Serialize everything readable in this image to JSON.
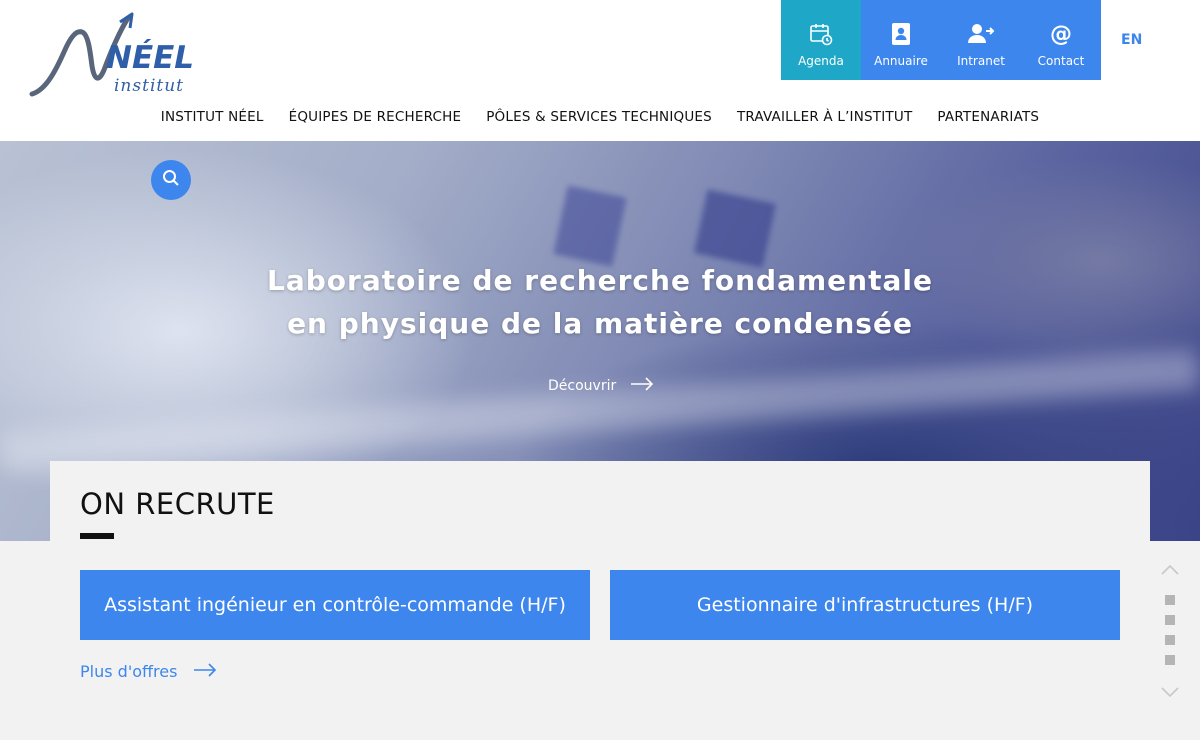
{
  "header": {
    "logo_text": "NÉEL",
    "logo_subtext": "institut",
    "quick_links": [
      {
        "label": "Agenda",
        "icon": "calendar-icon",
        "color": "#1ea7c6"
      },
      {
        "label": "Annuaire",
        "icon": "address-book-icon",
        "color": "#3d86ee"
      },
      {
        "label": "Intranet",
        "icon": "user-login-icon",
        "color": "#3d86ee"
      },
      {
        "label": "Contact",
        "icon": "at-icon",
        "color": "#3d86ee"
      }
    ],
    "lang": "EN"
  },
  "nav": {
    "items": [
      {
        "label": "INSTITUT NÉEL"
      },
      {
        "label": "ÉQUIPES DE RECHERCHE"
      },
      {
        "label": "PÔLES & SERVICES TECHNIQUES"
      },
      {
        "label": "TRAVAILLER À L’INSTITUT"
      },
      {
        "label": "PARTENARIATS"
      }
    ]
  },
  "hero": {
    "title_line1": "Laboratoire de recherche fondamentale",
    "title_line2": "en physique de la matière condensée",
    "cta": "Découvrir"
  },
  "recruiting": {
    "title": "ON RECRUTE",
    "jobs": [
      {
        "label": "Assistant ingénieur en contrôle-commande (H/F)"
      },
      {
        "label": "Gestionnaire d'infrastructures (H/F)"
      }
    ],
    "more": "Plus d'offres"
  },
  "pager": {
    "slides": 4
  },
  "colors": {
    "accent": "#3d86ee",
    "agenda": "#1ea7c6",
    "text": "#111111",
    "background": "#f2f2f2"
  }
}
